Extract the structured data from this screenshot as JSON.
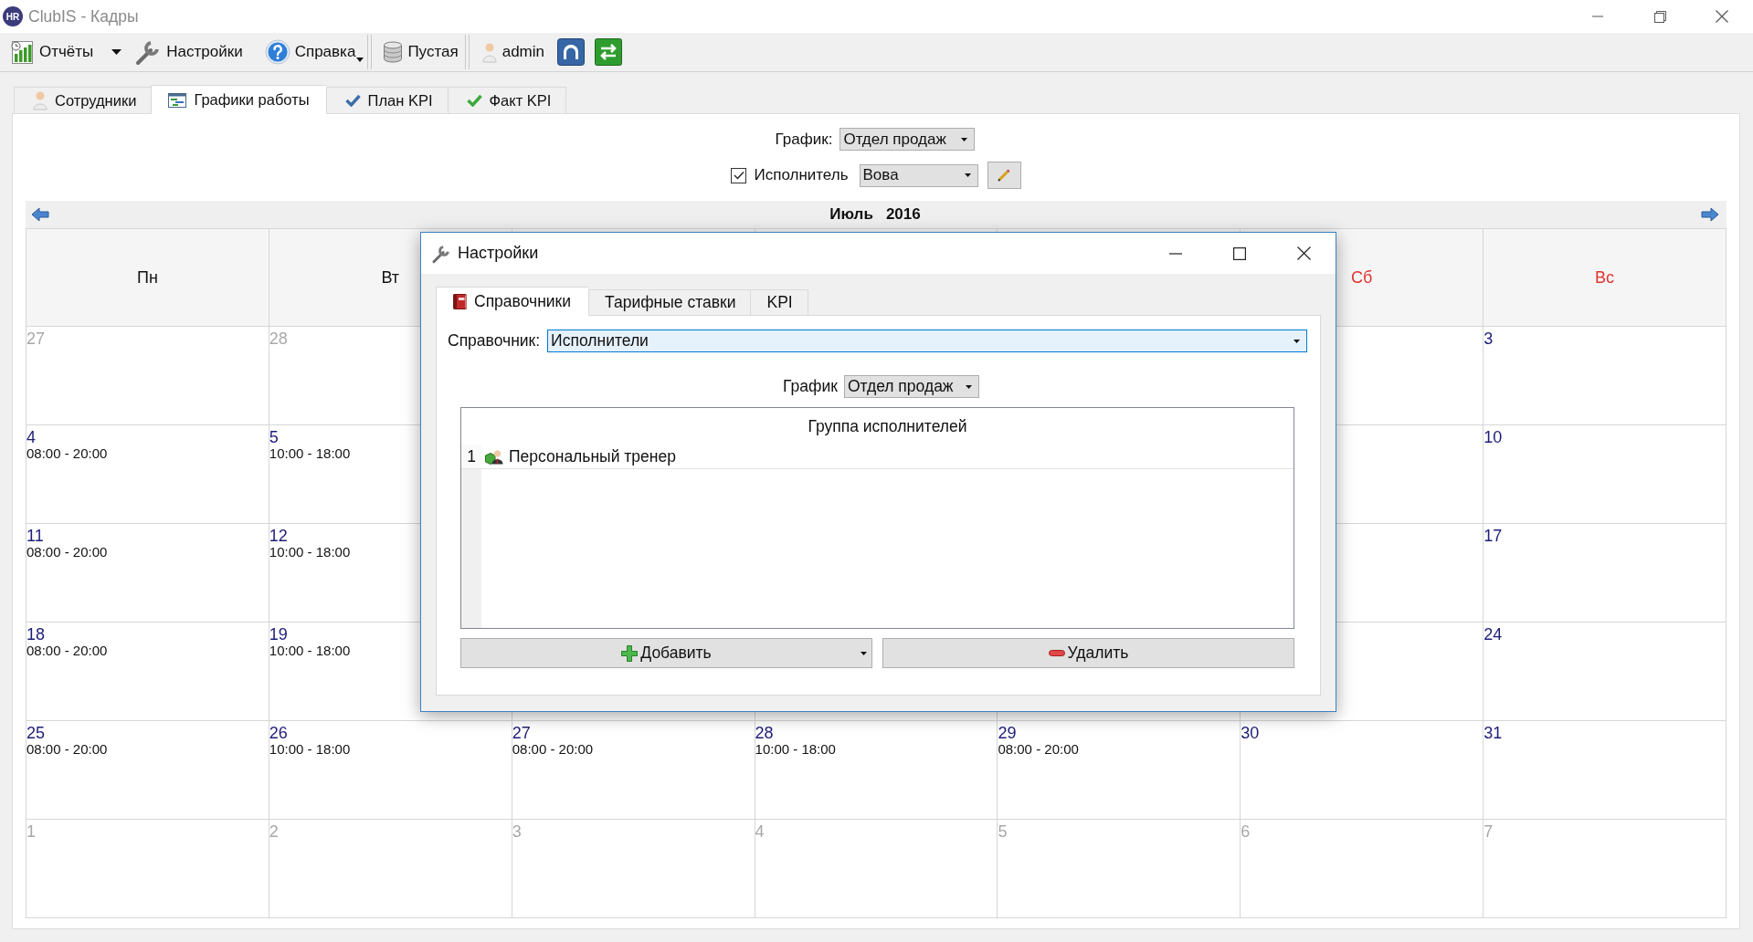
{
  "window": {
    "logo": "HR",
    "title": "ClubIS - Кадры"
  },
  "toolbar": {
    "reports": "Отчёты",
    "settings": "Настройки",
    "help": "Справка",
    "database": "Пустая",
    "user": "admin"
  },
  "tabs": [
    {
      "label": "Сотрудники",
      "selected": false
    },
    {
      "label": "Графики работы",
      "selected": true
    },
    {
      "label": "План KPI",
      "selected": false
    },
    {
      "label": "Факт KPI",
      "selected": false
    }
  ],
  "schedule_filter": {
    "label": "График:",
    "value": "Отдел продаж"
  },
  "performer_filter": {
    "label": "Исполнитель",
    "checked": true,
    "value": "Вова"
  },
  "calendar": {
    "month": "Июль",
    "year": "2016",
    "day_headers": [
      {
        "label": "Пн",
        "weekend": false
      },
      {
        "label": "Вт",
        "weekend": false
      },
      {
        "label": "Сб",
        "weekend": true
      },
      {
        "label": "Вс",
        "weekend": true
      }
    ],
    "weeks": [
      {
        "days": [
          {
            "day": "27",
            "other_month": true
          },
          {
            "day": "28",
            "other_month": true
          },
          {
            "day": "3",
            "other_month": false
          }
        ]
      },
      {
        "days": [
          {
            "day": "4",
            "other_month": false,
            "shift": "08:00 - 20:00"
          },
          {
            "day": "5",
            "other_month": false,
            "shift": "10:00 - 18:00"
          },
          {
            "day": "10",
            "other_month": false
          }
        ]
      },
      {
        "days": [
          {
            "day": "11",
            "other_month": false,
            "shift": "08:00 - 20:00"
          },
          {
            "day": "12",
            "other_month": false,
            "shift": "10:00 - 18:00"
          },
          {
            "day": "17",
            "other_month": false
          }
        ]
      },
      {
        "days": [
          {
            "day": "18",
            "other_month": false,
            "shift": "08:00 - 20:00"
          },
          {
            "day": "19",
            "other_month": false,
            "shift": "10:00 - 18:00"
          },
          {
            "day": "24",
            "other_month": false
          }
        ]
      },
      {
        "days": [
          {
            "day": "25",
            "other_month": false,
            "shift": "08:00 - 20:00"
          },
          {
            "day": "26",
            "other_month": false,
            "shift": "10:00 - 18:00"
          },
          {
            "day": "27",
            "other_month": false,
            "shift": "08:00 - 20:00"
          },
          {
            "day": "28",
            "other_month": false,
            "shift": "10:00 - 18:00"
          },
          {
            "day": "29",
            "other_month": false,
            "shift": "08:00 - 20:00"
          },
          {
            "day": "30",
            "other_month": false
          },
          {
            "day": "31",
            "other_month": false
          }
        ]
      },
      {
        "days": [
          {
            "day": "1",
            "other_month": true
          },
          {
            "day": "2",
            "other_month": true
          },
          {
            "day": "3",
            "other_month": true
          },
          {
            "day": "4",
            "other_month": true
          },
          {
            "day": "5",
            "other_month": true
          },
          {
            "day": "6",
            "other_month": true
          },
          {
            "day": "7",
            "other_month": true
          }
        ]
      }
    ]
  },
  "dialog": {
    "title": "Настройки",
    "tabs": [
      {
        "label": "Справочники",
        "selected": true
      },
      {
        "label": "Тарифные ставки",
        "selected": false
      },
      {
        "label": "KPI",
        "selected": false
      }
    ],
    "catalog": {
      "label": "Справочник:",
      "value": "Исполнители"
    },
    "schedule": {
      "label": "График",
      "value": "Отдел продаж"
    },
    "table": {
      "columns": [
        "Группа исполнителей"
      ],
      "rows": [
        {
          "number": "1",
          "name": "Персональный тренер"
        }
      ]
    },
    "buttons": [
      {
        "kind": "add",
        "label": "Добавить"
      },
      {
        "kind": "delete",
        "label": "Удалить"
      }
    ]
  }
}
